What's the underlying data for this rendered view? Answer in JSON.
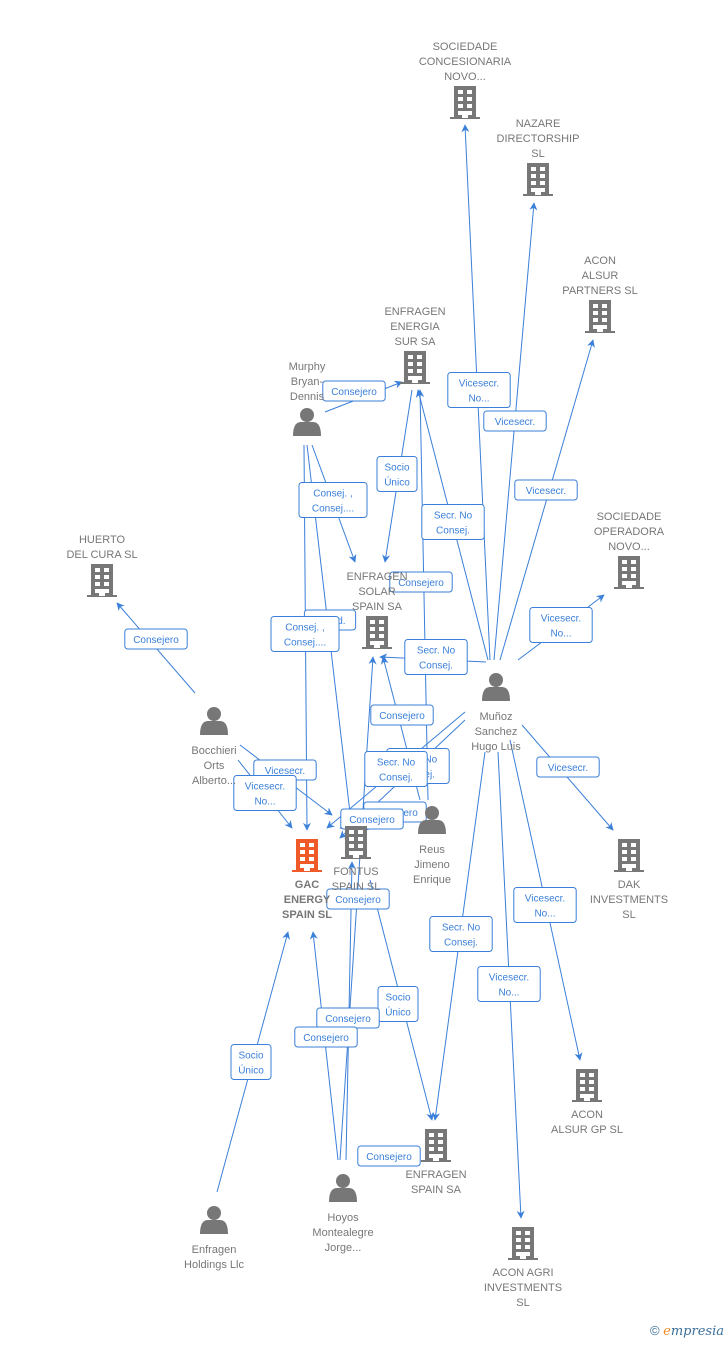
{
  "colors": {
    "edge": "#3a7fd9",
    "node": "#777777",
    "highlight": "#f05a28"
  },
  "nodes": [
    {
      "id": "soc_conc",
      "type": "company",
      "label": [
        "SOCIEDADE",
        "CONCESIONARIA",
        "NOVO..."
      ]
    },
    {
      "id": "nazare",
      "type": "company",
      "label": [
        "NAZARE",
        "DIRECTORSHIP",
        "SL"
      ]
    },
    {
      "id": "acon_partners",
      "type": "company",
      "label": [
        "ACON",
        "ALSUR",
        "PARTNERS  SL"
      ]
    },
    {
      "id": "enf_sur",
      "type": "company",
      "label": [
        "ENFRAGEN",
        "ENERGIA",
        "SUR SA"
      ]
    },
    {
      "id": "murphy",
      "type": "person",
      "label": [
        "Murphy",
        "Bryan-",
        "Dennis"
      ]
    },
    {
      "id": "huerto",
      "type": "company",
      "label": [
        "HUERTO",
        "DEL CURA  SL"
      ]
    },
    {
      "id": "enf_solar",
      "type": "company",
      "label": [
        "ENFRAGEN",
        "SOLAR",
        "SPAIN SA"
      ]
    },
    {
      "id": "soc_oper",
      "type": "company",
      "label": [
        "SOCIEDADE",
        "OPERADORA",
        "NOVO..."
      ]
    },
    {
      "id": "munoz",
      "type": "person",
      "label": [
        "Muñoz",
        "Sanchez",
        "Hugo Luis"
      ]
    },
    {
      "id": "bocchieri",
      "type": "person",
      "label": [
        "Bocchieri",
        "Orts",
        "Alberto..."
      ]
    },
    {
      "id": "gac",
      "type": "company",
      "main": true,
      "label": [
        "GAC",
        "ENERGY",
        "SPAIN  SL"
      ]
    },
    {
      "id": "fontus",
      "type": "company",
      "label": [
        "FONTUS",
        "SPAIN  SL"
      ]
    },
    {
      "id": "reus",
      "type": "person",
      "label": [
        "Reus",
        "Jimeno",
        "Enrique"
      ]
    },
    {
      "id": "dak",
      "type": "company",
      "label": [
        "DAK",
        "INVESTMENTS",
        "SL"
      ]
    },
    {
      "id": "holdings",
      "type": "person",
      "label": [
        "Enfragen",
        "Holdings Llc"
      ]
    },
    {
      "id": "hoyos",
      "type": "person",
      "label": [
        "Hoyos",
        "Montealegre",
        "Jorge..."
      ]
    },
    {
      "id": "enf_spain",
      "type": "company",
      "label": [
        "ENFRAGEN",
        "SPAIN SA"
      ]
    },
    {
      "id": "acon_gp",
      "type": "company",
      "label": [
        "ACON",
        "ALSUR GP  SL"
      ]
    },
    {
      "id": "acon_agri",
      "type": "company",
      "label": [
        "ACON AGRI",
        "INVESTMENTS",
        "SL"
      ]
    }
  ],
  "edges": [
    {
      "id": "e1",
      "from": "munoz",
      "to": "soc_conc",
      "label": [
        "Vicesecr.",
        "No..."
      ]
    },
    {
      "id": "e2",
      "from": "munoz",
      "to": "nazare",
      "label": [
        "Vicesecr."
      ]
    },
    {
      "id": "e3",
      "from": "munoz",
      "to": "acon_partners",
      "label": [
        "Vicesecr."
      ]
    },
    {
      "id": "e4",
      "from": "munoz",
      "to": "enf_sur",
      "label": [
        "Secr.  No",
        "Consej."
      ]
    },
    {
      "id": "e5",
      "from": "munoz",
      "to": "soc_oper",
      "label": [
        "Vicesecr.",
        "No..."
      ]
    },
    {
      "id": "e6",
      "from": "munoz",
      "to": "enf_solar",
      "label": [
        "Secr.  No",
        "Consej."
      ]
    },
    {
      "id": "e7",
      "from": "munoz",
      "to": "fontus",
      "label": [
        "Secr.  No",
        "Consej."
      ]
    },
    {
      "id": "e8",
      "from": "munoz",
      "to": "gac",
      "label": [
        "Secr.  No",
        "Consej."
      ]
    },
    {
      "id": "e9",
      "from": "munoz",
      "to": "dak",
      "label": [
        "Vicesecr."
      ]
    },
    {
      "id": "e10",
      "from": "munoz",
      "to": "acon_gp",
      "label": [
        "Vicesecr.",
        "No..."
      ]
    },
    {
      "id": "e11",
      "from": "munoz",
      "to": "acon_agri",
      "label": [
        "Vicesecr.",
        "No..."
      ]
    },
    {
      "id": "e12",
      "from": "munoz",
      "to": "enf_spain",
      "label": [
        "Secr.  No",
        "Consej."
      ]
    },
    {
      "id": "e13",
      "from": "murphy",
      "to": "enf_sur",
      "label": [
        "Consejero"
      ]
    },
    {
      "id": "e14",
      "from": "murphy",
      "to": "enf_solar",
      "label": [
        "Consej. ,",
        "Consej...."
      ]
    },
    {
      "id": "e15",
      "from": "murphy",
      "to": "fontus",
      "label": [
        "Presid."
      ]
    },
    {
      "id": "e16",
      "from": "murphy",
      "to": "gac",
      "label": [
        "Consej. ,",
        "Consej...."
      ]
    },
    {
      "id": "e17",
      "from": "enf_sur",
      "to": "enf_solar",
      "label": [
        "Socio",
        "Único"
      ]
    },
    {
      "id": "e18",
      "from": "reus",
      "to": "enf_sur",
      "label": [
        "Consejero"
      ]
    },
    {
      "id": "e19",
      "from": "reus",
      "to": "enf_solar",
      "label": [
        "Consejero"
      ]
    },
    {
      "id": "e20",
      "from": "reus",
      "to": "fontus",
      "label": [
        "Consejero"
      ]
    },
    {
      "id": "e21",
      "from": "reus",
      "to": "gac",
      "label": [
        "Consejero"
      ]
    },
    {
      "id": "e22",
      "from": "bocchieri",
      "to": "huerto",
      "label": [
        "Consejero"
      ]
    },
    {
      "id": "e23",
      "from": "bocchieri",
      "to": "fontus",
      "label": [
        "Vicesecr."
      ]
    },
    {
      "id": "e24",
      "from": "bocchieri",
      "to": "gac",
      "label": [
        "Vicesecr.",
        "No..."
      ]
    },
    {
      "id": "e25",
      "from": "hoyos",
      "to": "enf_solar",
      "label": [
        "Consejero"
      ]
    },
    {
      "id": "e26",
      "from": "fontus",
      "to": "enf_spain",
      "label": [
        "Socio",
        "Único"
      ]
    },
    {
      "id": "e27",
      "from": "hoyos",
      "to": "fontus",
      "label": [
        "Consejero"
      ]
    },
    {
      "id": "e28",
      "from": "hoyos",
      "to": "gac",
      "label": [
        "Consejero"
      ]
    },
    {
      "id": "e29",
      "from": "holdings",
      "to": "gac",
      "label": [
        "Socio",
        "Único"
      ]
    },
    {
      "id": "e30",
      "from": "hoyos",
      "to": "enf_spain",
      "label": [
        "Consejero"
      ]
    }
  ],
  "watermark": {
    "symbol": "©",
    "brand_initial": "e",
    "brand_rest": "mpresia"
  }
}
